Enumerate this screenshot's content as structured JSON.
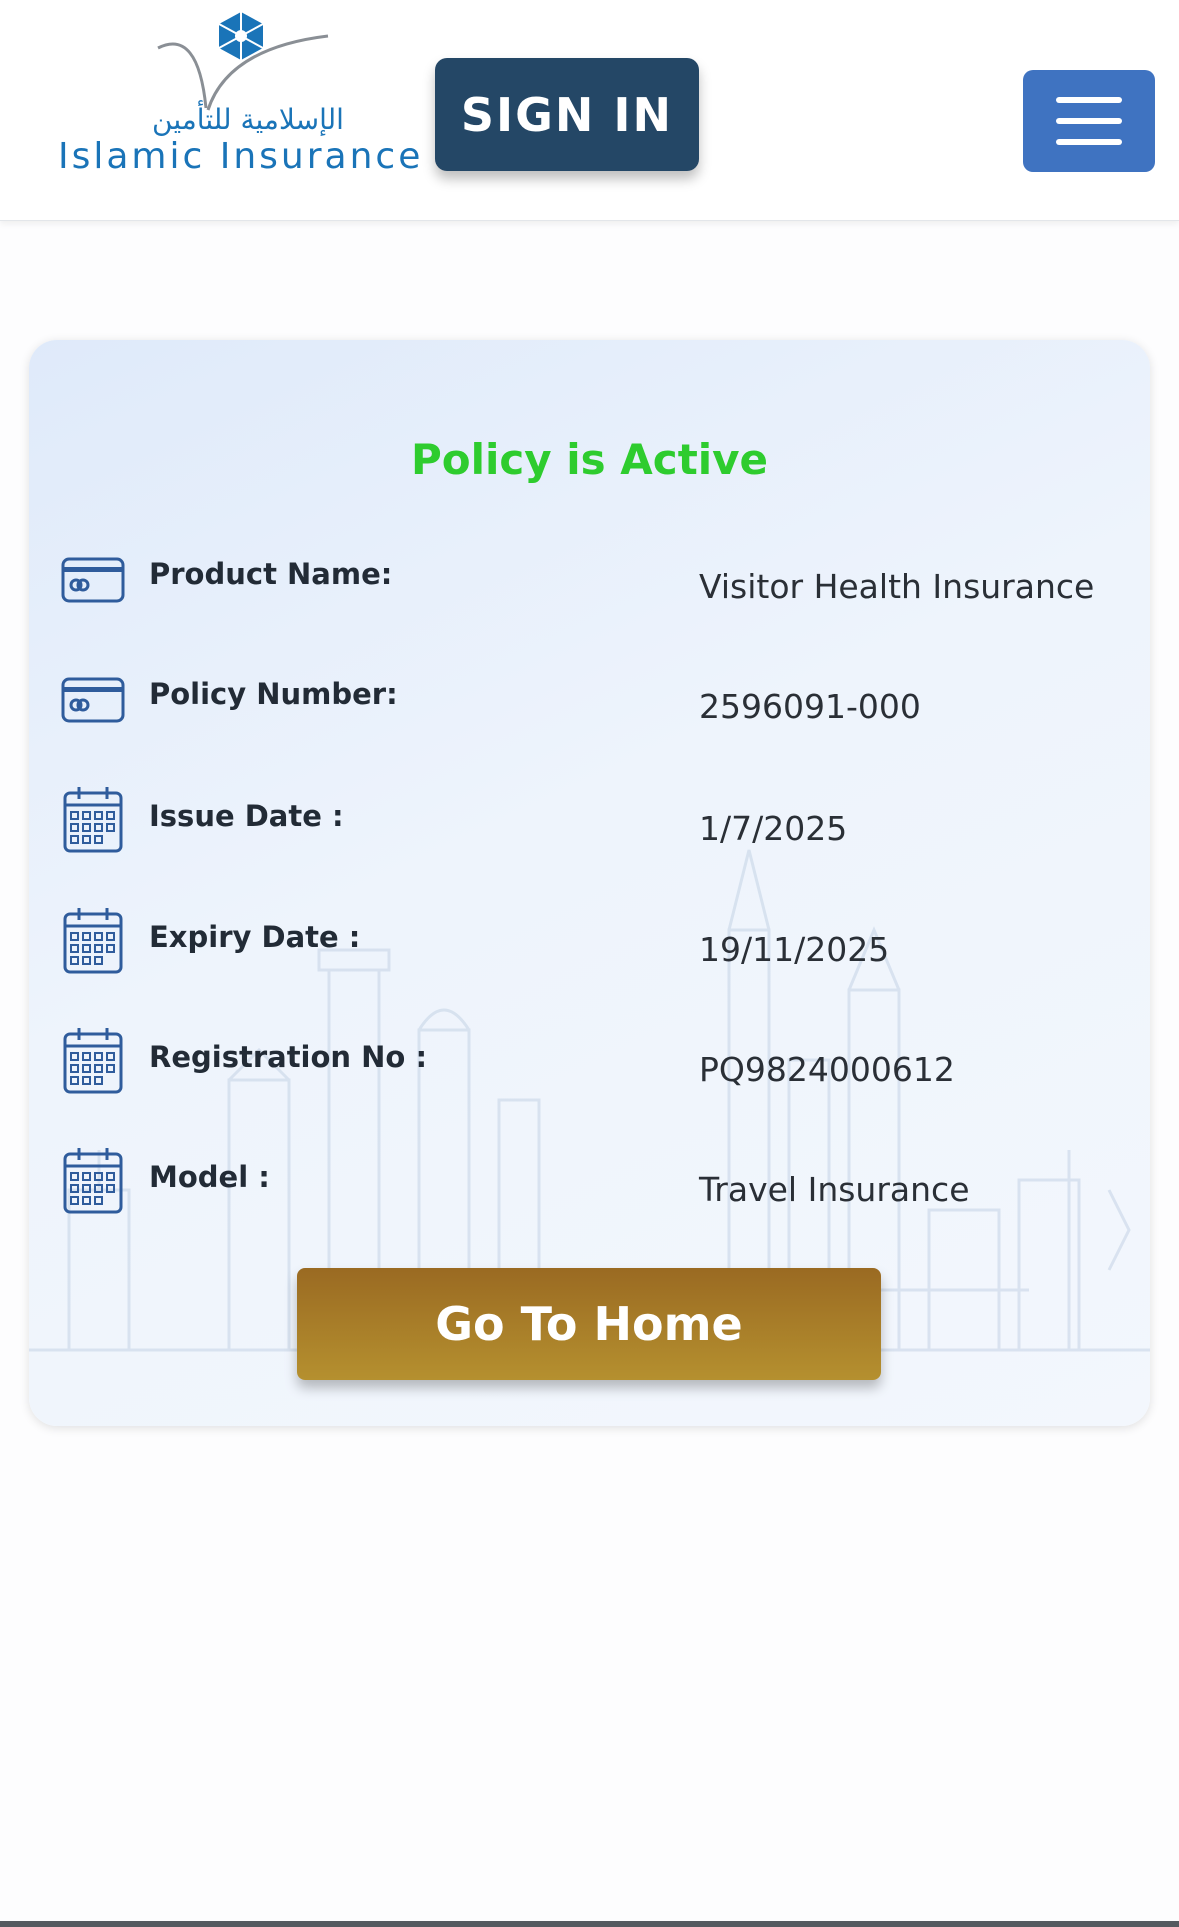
{
  "header": {
    "logo": {
      "arabic": "الإسلامية للتأمين",
      "english": "Islamic Insurance"
    },
    "sign_in_label": "SIGN IN",
    "menu_icon": "hamburger-menu-icon"
  },
  "policy": {
    "status": "Policy is Active",
    "rows": [
      {
        "label": "Product Name:",
        "value": "Visitor Health Insurance",
        "icon": "card-icon"
      },
      {
        "label": "Policy Number:",
        "value": "2596091-000",
        "icon": "card-icon"
      },
      {
        "label": "Issue Date :",
        "value": "1/7/2025",
        "icon": "calendar-icon"
      },
      {
        "label": "Expiry Date :",
        "value": "19/11/2025",
        "icon": "calendar-icon"
      },
      {
        "label": "Registration No :",
        "value": "PQ9824000612",
        "icon": "calendar-icon"
      },
      {
        "label": "Model :",
        "value": "Travel Insurance",
        "icon": "calendar-icon"
      }
    ],
    "home_button_label": "Go To Home"
  },
  "colors": {
    "brand_blue": "#1a74b8",
    "sign_in_bg": "#244766",
    "menu_bg": "#3f73c1",
    "status_green": "#2ecc2e",
    "home_button_gold": "#b5902f"
  }
}
